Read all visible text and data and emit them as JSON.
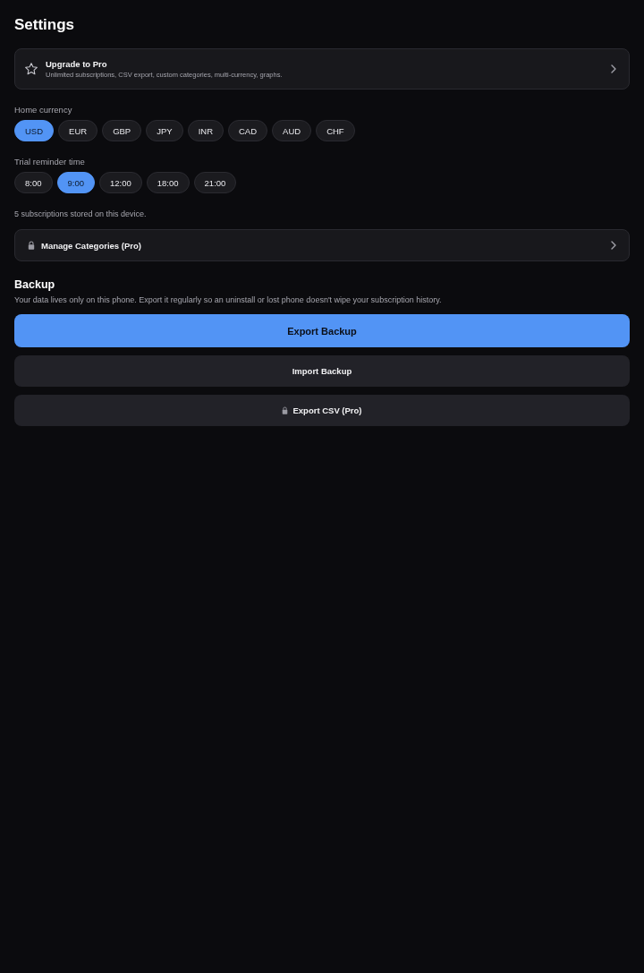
{
  "header": {
    "title": "Settings"
  },
  "upgrade_card": {
    "title": "Upgrade to Pro",
    "subtitle": "Unlimited subscriptions, CSV export, custom categories, multi-currency, graphs."
  },
  "currency": {
    "label": "Home currency",
    "options": [
      {
        "label": "USD",
        "selected": true
      },
      {
        "label": "EUR",
        "selected": false
      },
      {
        "label": "GBP",
        "selected": false
      },
      {
        "label": "JPY",
        "selected": false
      },
      {
        "label": "INR",
        "selected": false
      },
      {
        "label": "CAD",
        "selected": false
      },
      {
        "label": "AUD",
        "selected": false
      },
      {
        "label": "CHF",
        "selected": false
      }
    ]
  },
  "reminder": {
    "label": "Trial reminder time",
    "options": [
      {
        "label": "8:00",
        "selected": false
      },
      {
        "label": "9:00",
        "selected": true
      },
      {
        "label": "12:00",
        "selected": false
      },
      {
        "label": "18:00",
        "selected": false
      },
      {
        "label": "21:00",
        "selected": false
      }
    ]
  },
  "storage_note": "5 subscriptions stored on this device.",
  "manage_categories": {
    "label": "Manage Categories (Pro)",
    "locked": true
  },
  "backup": {
    "title": "Backup",
    "description": "Your data lives only on this phone. Export it regularly so an uninstall or lost phone doesn't wipe your subscription history.",
    "buttons": [
      {
        "label": "Export Backup",
        "kind": "primary",
        "locked": false
      },
      {
        "label": "Import Backup",
        "kind": "secondary",
        "locked": false
      },
      {
        "label": "Export CSV (Pro)",
        "kind": "secondary",
        "locked": true
      }
    ]
  }
}
